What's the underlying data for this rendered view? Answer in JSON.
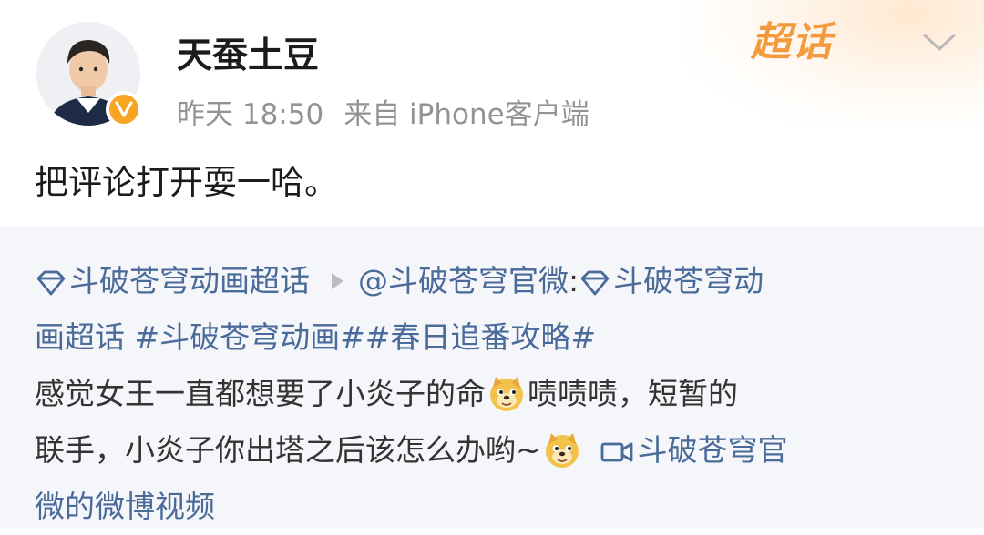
{
  "post": {
    "username": "天蚕土豆",
    "time": "昨天 18:50",
    "source": "来自 iPhone客户端",
    "supertopic_badge": "超话",
    "content": "把评论打开耍一哈。"
  },
  "icons": {
    "verified": "verified-v-badge-icon",
    "menu": "chevron-down-icon",
    "supertopic": "diamond-icon",
    "video": "video-camera-icon",
    "emoji": "doge-emoji-icon"
  },
  "colors": {
    "link": "#4a6a99",
    "meta": "#939393",
    "badge": "#f39a3f",
    "verified": "#f6a623",
    "repost_bg": "#f5f6f9"
  },
  "repost": {
    "line1": {
      "topic1": "斗破苍穹动画超话",
      "author": "@斗破苍穹官微",
      "colon": " :",
      "topic2_part1": "斗破苍穹动"
    },
    "line2": {
      "topic2_part2": "画超话",
      "hashtags": " #斗破苍穹动画##春日追番攻略#"
    },
    "line3": {
      "text_a": "感觉女王一直都想要了小炎子的命",
      "text_b": "啧啧啧，短暂的"
    },
    "line4": {
      "text": "联手，小炎子你出塔之后该怎么办哟~",
      "video_part1": "斗破苍穹官"
    },
    "line5": {
      "video_part2": "微的微博视频"
    }
  }
}
